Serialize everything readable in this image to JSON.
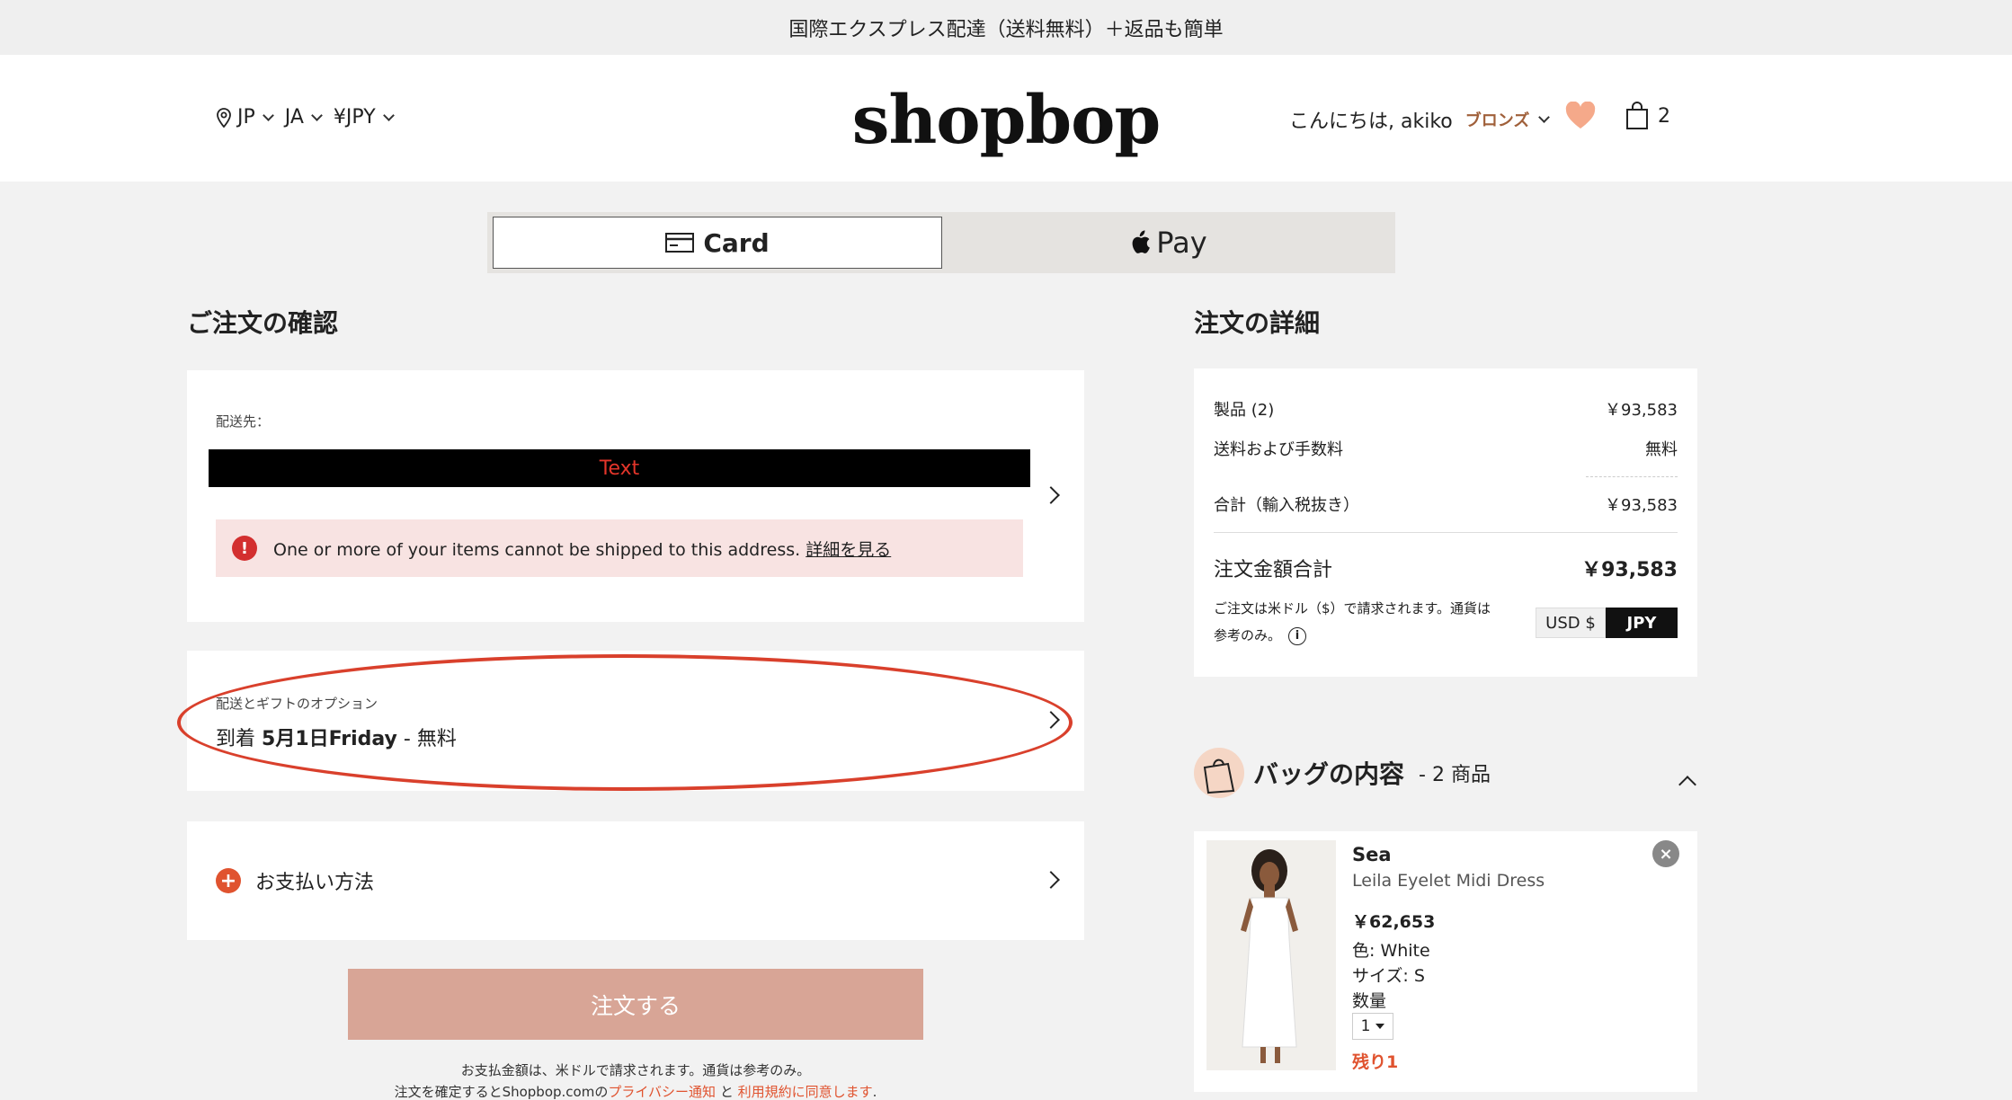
{
  "promo": "国際エクスプレス配達（送料無料）＋返品も簡単",
  "header": {
    "country": "JP",
    "language": "JA",
    "currency": "¥JPY",
    "logo": "shopbop",
    "greeting": "こんにちは, akiko",
    "tier": "ブロンズ",
    "bag_count": "2",
    "accent_color": "#f5a98a"
  },
  "payment_toggle": {
    "card_label": "Card",
    "apple_label": "Pay"
  },
  "review": {
    "title": "ご注文の確認",
    "ship_to_label": "配送先：",
    "redaction_label": "Text",
    "alert_text": "One or more of your items cannot be shipped to this address.",
    "alert_link": "詳細を見る",
    "options_label": "配送とギフトのオプション",
    "delivery_prefix": "到着",
    "delivery_date": "5月1日Friday",
    "delivery_suffix": " - 無料",
    "payment_method": "お支払い方法",
    "order_button": "注文する",
    "fine1": "お支払金額は、米ドルで請求されます。通貨は参考のみ。",
    "fine2_pre": "注文を確定するとShopbop.comの",
    "fine2_privacy": "プライバシー通知",
    "fine2_and": "と",
    "fine2_terms": "利用規約に同意します",
    "fine2_end": "."
  },
  "details": {
    "title": "注文の詳細",
    "products_label": "製品 (2)",
    "products_value": "￥93,583",
    "shipping_label": "送料および手数料",
    "shipping_value": "無料",
    "subtotal_label": "合計（輸入税抜き）",
    "subtotal_value": "￥93,583",
    "total_label": "注文金額合計",
    "total_value": "￥93,583",
    "note": "ご注文は米ドル（$）で請求されます。通貨は参考のみ。",
    "usd_label": "USD $",
    "jpy_label": "JPY"
  },
  "bag": {
    "title": "バッグの内容",
    "count": "- 2 商品",
    "items": [
      {
        "brand": "Sea",
        "name": "Leila Eyelet Midi Dress",
        "price": "￥62,653",
        "color": "色: White",
        "size": "サイズ: S",
        "qty_label": "数量",
        "qty": "1",
        "remaining": "残り1"
      }
    ]
  }
}
